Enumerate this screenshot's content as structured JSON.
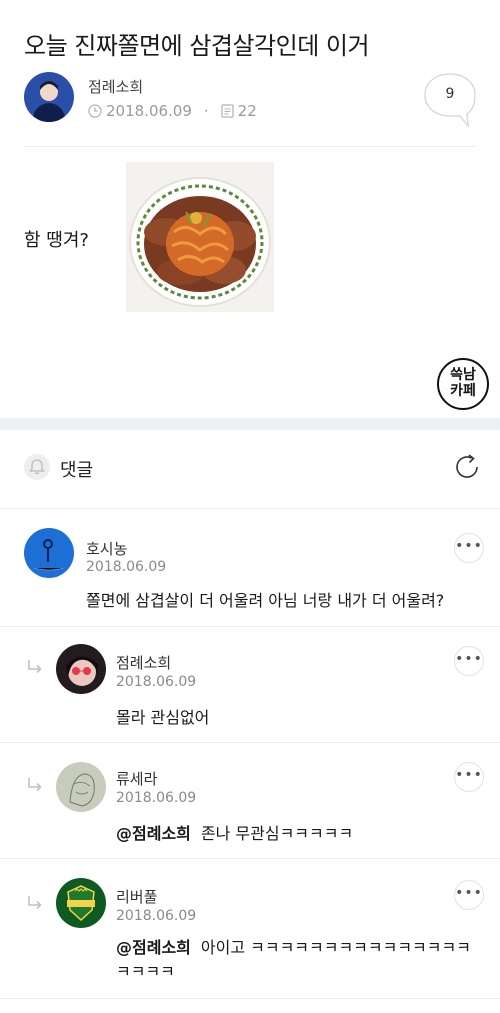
{
  "post": {
    "title": "오늘 진짜쫄면에 삼겹살각인데 이거",
    "author": "점례소희",
    "date": "2018.06.09",
    "views": "22",
    "comment_count": "9",
    "body_text": "함 땡겨?",
    "cafe_logo": [
      "쓱남",
      "카페"
    ]
  },
  "comments_section": {
    "label": "댓글"
  },
  "comments": [
    {
      "author": "호시농",
      "date": "2018.06.09",
      "mention": "",
      "text": "쫄면에 삼겹살이 더 어울려 아님 너랑 내가 더 어울려?",
      "reply": false,
      "avatar_color": "#1d6fd6"
    },
    {
      "author": "점례소희",
      "date": "2018.06.09",
      "mention": "",
      "text": "몰라 관심없어",
      "reply": true,
      "avatar_color": "#2a1f24"
    },
    {
      "author": "류세라",
      "date": "2018.06.09",
      "mention": "@점례소희",
      "text": "존나 무관심ㅋㅋㅋㅋㅋ",
      "reply": true,
      "avatar_color": "#b9bfb0"
    },
    {
      "author": "리버풀",
      "date": "2018.06.09",
      "mention": "@점례소희",
      "text": "아이고 ㅋㅋㅋㅋㅋㅋㅋㅋㅋㅋㅋㅋㅋㅋㅋㅋㅋㅋㅋ",
      "reply": true,
      "avatar_color": "#1e7a2e"
    }
  ]
}
